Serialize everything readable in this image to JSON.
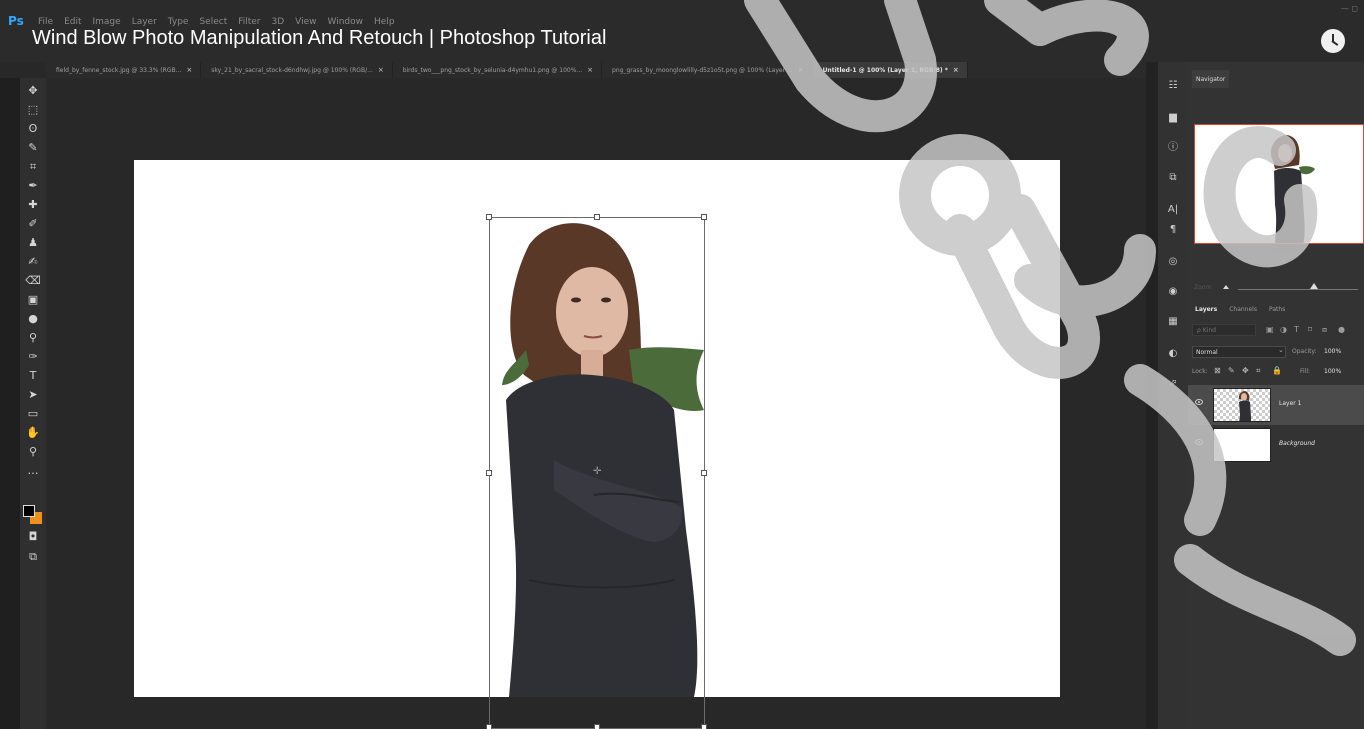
{
  "app": {
    "logo": "Ps",
    "window_controls": "— ◻"
  },
  "menu": [
    "File",
    "Edit",
    "Image",
    "Layer",
    "Type",
    "Select",
    "Filter",
    "3D",
    "View",
    "Window",
    "Help"
  ],
  "video": {
    "title": "Wind Blow Photo Manipulation And Retouch | Photoshop Tutorial"
  },
  "tabs": [
    {
      "label": "field_by_fenne_stock.jpg @ 33.3% (RGB...",
      "close": "×"
    },
    {
      "label": "sky_21_by_sacral_stock-d6ndhwj.jpg @ 100% (RGB/...",
      "close": "×"
    },
    {
      "label": "birds_two___png_stock_by_selunia-d4ymhu1.png @ 100%...",
      "close": "×"
    },
    {
      "label": "png_grass_by_moonglowlilly-d5z1o5t.png @ 100% (Layer ...",
      "close": "×"
    },
    {
      "label": "Untitled-1 @ 100% (Layer 1, RGB/8) *",
      "close": "×",
      "active": true
    }
  ],
  "tools": [
    "move-tool",
    "marquee-tool",
    "lasso-tool",
    "quick-select-tool",
    "crop-tool",
    "eyedropper-tool",
    "healing-brush-tool",
    "brush-tool",
    "clone-stamp-tool",
    "history-brush-tool",
    "eraser-tool",
    "gradient-tool",
    "blur-tool",
    "dodge-tool",
    "pen-tool",
    "type-tool",
    "path-select-tool",
    "rectangle-tool",
    "hand-tool",
    "zoom-tool",
    "more-tools"
  ],
  "swatches": {
    "foreground": "#000000",
    "background": "#f0901c"
  },
  "colors": {
    "accent": "#31a8ff",
    "nav_frame": "#e0442f"
  },
  "navigator": {
    "tab": "Navigator",
    "zoom_label": "Zoom"
  },
  "layers_panel": {
    "tabs": [
      "Layers",
      "Channels",
      "Paths"
    ],
    "kind_placeholder": "ρ Kind",
    "blend_mode": "Normal",
    "opacity_label": "Opacity:",
    "opacity_value": "100%",
    "lock_label": "Lock:",
    "fill_label": "Fill:",
    "fill_value": "100%",
    "layers": [
      {
        "name": "Layer 1",
        "selected": true,
        "visible": true
      },
      {
        "name": "Background",
        "selected": false,
        "visible": true,
        "italic": true
      }
    ]
  }
}
